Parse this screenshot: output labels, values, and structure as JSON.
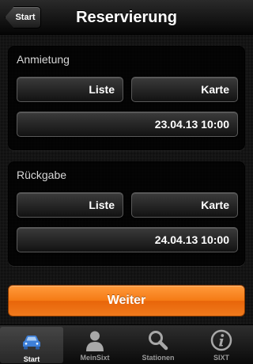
{
  "navbar": {
    "back_label": "Start",
    "title": "Reservierung"
  },
  "pickup": {
    "label": "Anmietung",
    "list_label": "Liste",
    "map_label": "Karte",
    "datetime": "23.04.13 10:00"
  },
  "return": {
    "label": "Rückgabe",
    "list_label": "Liste",
    "map_label": "Karte",
    "datetime": "24.04.13 10:00"
  },
  "continue_label": "Weiter",
  "tabs": [
    {
      "label": "Start",
      "icon": "car-icon",
      "active": true
    },
    {
      "label": "MeinSixt",
      "icon": "person-icon",
      "active": false
    },
    {
      "label": "Stationen",
      "icon": "search-icon",
      "active": false
    },
    {
      "label": "SIXT",
      "icon": "info-icon",
      "active": false
    }
  ],
  "colors": {
    "accent": "#f57a14",
    "active_icon": "#3d7fd8"
  }
}
